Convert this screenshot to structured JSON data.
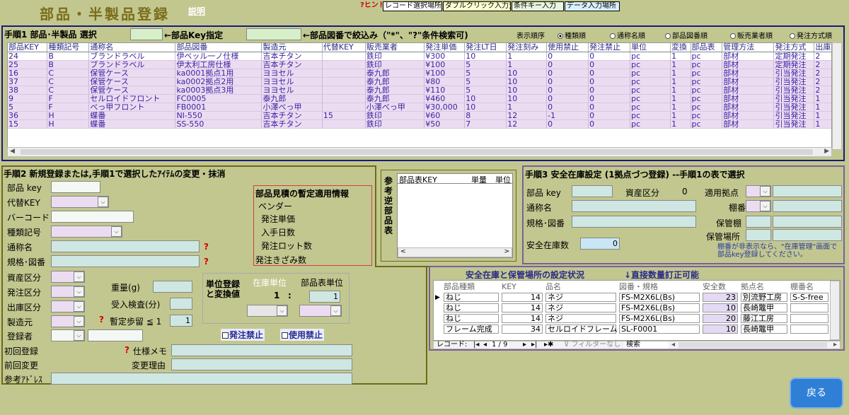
{
  "app": {
    "title": "部品・半製品登録",
    "help": "説明"
  },
  "top_buttons": {
    "hint": "?ヒント",
    "rec": "レコード選択場所",
    "dbl": "ダブルクリック入力支援",
    "cond": "条件キー入力",
    "data": "データ入力場所"
  },
  "step1": {
    "title": "手順1 部品･半製品 選択",
    "key_label": "←部品Key指定",
    "filter_label": "←部品図番で絞込み（\"*\"、\"?\"条件検索可)",
    "sort_label": "表示順序",
    "sort_options": [
      "種類順",
      "通称名順",
      "部品図番順",
      "販売業者順",
      "発注方式順"
    ],
    "headers": [
      "部品KEY",
      "種類記号",
      "通称名",
      "部品図番",
      "製造元",
      "代替KEY",
      "販売業者",
      "発注単価",
      "発注LT日",
      "発注刻み",
      "使用禁止",
      "発注禁止",
      "単位",
      "変換",
      "部品表",
      "管理方法",
      "発注方式",
      "出庫"
    ],
    "rows": [
      [
        "24",
        "B",
        "ブランドラベル",
        "伊ベッル一ノ仕様",
        "吉本チタン",
        "",
        "鉄印",
        "¥300",
        "10",
        "1",
        "0",
        "0",
        "pc",
        "1",
        "pc",
        "部材",
        "定期発注",
        "2"
      ],
      [
        "25",
        "B",
        "ブランドラベル",
        "伊太利工房仕様",
        "吉本チタン",
        "",
        "鉄印",
        "¥100",
        "5",
        "1",
        "0",
        "0",
        "pc",
        "1",
        "pc",
        "部材",
        "定期発注",
        "2"
      ],
      [
        "16",
        "C",
        "保管ケース",
        "ka0001拠点1用",
        "ヨヨセル",
        "",
        "泰九郎",
        "¥100",
        "5",
        "10",
        "0",
        "0",
        "pc",
        "1",
        "pc",
        "部材",
        "引当発注",
        "2"
      ],
      [
        "37",
        "C",
        "保管ケース",
        "ka0002拠点2用",
        "ヨヨセル",
        "",
        "泰九郎",
        "¥80",
        "5",
        "10",
        "0",
        "0",
        "pc",
        "1",
        "pc",
        "部材",
        "引当発注",
        "2"
      ],
      [
        "38",
        "C",
        "保管ケース",
        "ka0003拠点3用",
        "ヨヨセル",
        "",
        "泰九郎",
        "¥110",
        "5",
        "10",
        "0",
        "0",
        "pc",
        "1",
        "pc",
        "部材",
        "引当発注",
        "2"
      ],
      [
        "9",
        "F",
        "セルロイドフロント",
        "FC0005",
        "泰九郎",
        "",
        "泰九郎",
        "¥460",
        "10",
        "10",
        "0",
        "0",
        "pc",
        "1",
        "pc",
        "部材",
        "引当発注",
        "1"
      ],
      [
        "5",
        "F",
        "べっ甲フロント",
        "FB0001",
        "小澤べっ甲",
        "",
        "小澤べっ甲",
        "¥30,000",
        "10",
        "1",
        "0",
        "0",
        "pc",
        "1",
        "pc",
        "部材",
        "引当発注",
        "1"
      ],
      [
        "36",
        "H",
        "蝶番",
        "NI-550",
        "吉本チタン",
        "15",
        "鉄印",
        "¥60",
        "8",
        "12",
        "-1",
        "0",
        "pc",
        "1",
        "pc",
        "部材",
        "引当発注",
        "1"
      ],
      [
        "15",
        "H",
        "蝶番",
        "SS-550",
        "吉本チタン",
        "",
        "鉄印",
        "¥50",
        "7",
        "12",
        "0",
        "0",
        "pc",
        "1",
        "pc",
        "部材",
        "引当発注",
        "1"
      ]
    ]
  },
  "step2": {
    "title": "手順2 新規登録または,手順1で選択したｱｲﾃﾑの変更・抹消",
    "labels": {
      "key": "部品 key",
      "alt": "代替KEY",
      "barcode": "バーコード",
      "kind": "種類記号",
      "name": "通称名",
      "spec": "規格･図番",
      "asset": "資産区分",
      "order": "発注区分",
      "ship": "出庫区分",
      "maker": "製造元",
      "reg": "登録者",
      "first": "初回登録",
      "prev": "前回変更",
      "addr": "参考ｱﾄﾞﾚｽ",
      "weight": "重量(g)",
      "inspect": "受入検査(分)",
      "yield": "暫定歩留 ≦ 1",
      "memo": "仕様メモ",
      "reason": "変更理由"
    },
    "yield_value": "1",
    "estimate": {
      "title": "部品見積の暫定適用情報",
      "items": [
        "ベンダー",
        "発注単価",
        "入手日数",
        "発注ロット数",
        "発注きざみ数"
      ]
    },
    "unit": {
      "title1": "単位登録",
      "title2": "と変換値",
      "stock": "在庫単位",
      "bom": "部品表単位",
      "one": "1",
      "colon": ":",
      "bom_val": "1"
    },
    "chk_order": "発注禁止",
    "chk_use": "使用禁止"
  },
  "bom": {
    "side": "参考逆部品表",
    "headers": [
      "部品表KEY",
      "単量",
      "単位"
    ]
  },
  "step3": {
    "title": "手順3 安全在庫設定 (1拠点づつ登録) --手順1の表で選択",
    "key": "部品 key",
    "asset": "資産区分",
    "asset_val": "0",
    "site": "適用拠点",
    "name": "通称名",
    "shelf": "棚番",
    "spec": "規格･図番",
    "keep_shelf": "保管棚",
    "safety": "安全在庫数",
    "safety_val": "0",
    "keep_place": "保管場所",
    "note": "棚番が非表示なら、\"在庫管理\"画面で部品key登録してください。"
  },
  "safety": {
    "title": "安全在庫と保管場所の設定状況",
    "arrow": "↓直接数量訂正可能",
    "headers": [
      "部品種類",
      "KEY",
      "品名",
      "図番・規格",
      "安全数",
      "拠点名",
      "棚番名"
    ],
    "rows": [
      [
        "ねじ",
        "14",
        "ネジ",
        "FS-M2X6L(Bs)",
        "23",
        "別流野工房",
        "S-S-free"
      ],
      [
        "ねじ",
        "14",
        "ネジ",
        "FS-M2X6L(Bs)",
        "10",
        "長崎鼈甲",
        ""
      ],
      [
        "ねじ",
        "14",
        "ネジ",
        "FS-M2X6L(Bs)",
        "20",
        "藤江工房",
        ""
      ],
      [
        "フレーム完成",
        "34",
        "セルロイドフレーム",
        "SL-F0001",
        "10",
        "長崎鼈甲",
        ""
      ]
    ],
    "nav": {
      "record": "レコード:",
      "pos": "1 / 9",
      "filter": "フィルターなし",
      "search": "検索"
    }
  },
  "back": "戻る",
  "colors": {
    "bg": "#c2c78f",
    "accent": "#2f7fd6"
  }
}
